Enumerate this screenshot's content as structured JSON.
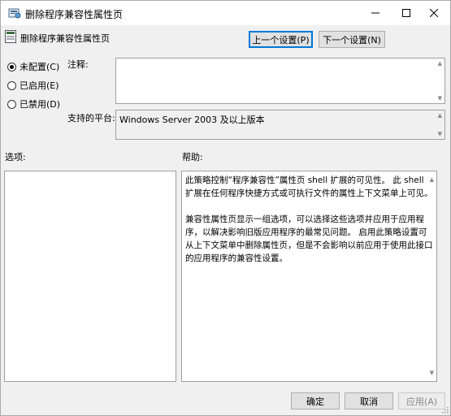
{
  "window": {
    "title": "删除程序兼容性属性页"
  },
  "policy": {
    "name": "删除程序兼容性属性页"
  },
  "nav": {
    "prev_label": "上一个设置(P)",
    "next_label": "下一个设置(N)"
  },
  "state": {
    "options": [
      {
        "label": "未配置(C)",
        "checked": true
      },
      {
        "label": "已启用(E)",
        "checked": false
      },
      {
        "label": "已禁用(D)",
        "checked": false
      }
    ]
  },
  "comment": {
    "label": "注释:",
    "value": ""
  },
  "platform": {
    "label": "支持的平台:",
    "value": "Windows Server 2003 及以上版本"
  },
  "sections": {
    "options_label": "选项:",
    "help_label": "帮助:"
  },
  "help": {
    "paragraphs": [
      "此策略控制“程序兼容性”属性页 shell 扩展的可见性。 此 shell 扩展在任何程序快捷方式或可执行文件的属性上下文菜单上可见。",
      "兼容性属性页显示一组选项，可以选择这些选项并应用于应用程序，以解决影响旧版应用程序的最常见问题。 启用此策略设置可从上下文菜单中删除属性页，但是不会影响以前应用于使用此接口的应用程序的兼容性设置。"
    ]
  },
  "footer": {
    "ok_label": "确定",
    "cancel_label": "取消",
    "apply_label": "应用(A)"
  }
}
